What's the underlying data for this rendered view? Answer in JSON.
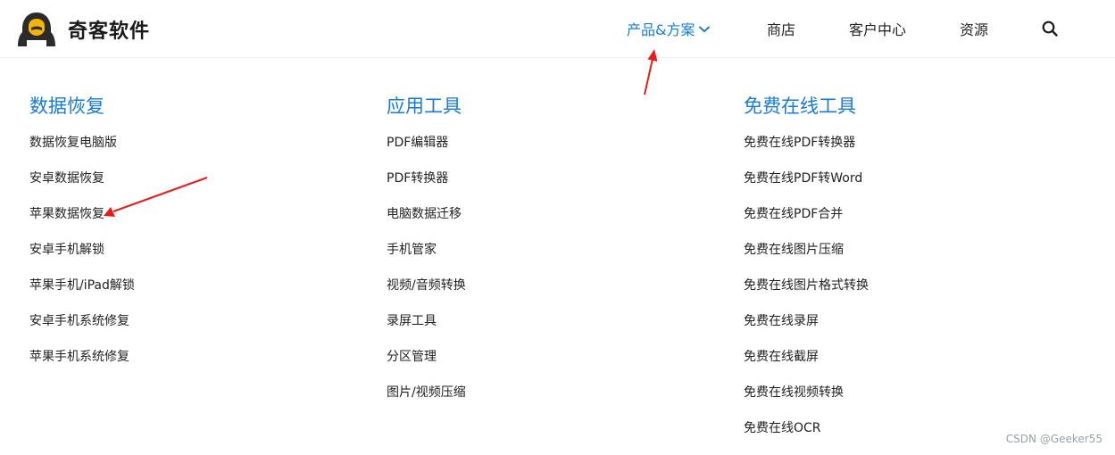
{
  "brand": {
    "name": "奇客软件",
    "logo_icon": "hooded-figure-icon"
  },
  "nav": {
    "products_label": "产品&方案",
    "store_label": "商店",
    "support_label": "客户中心",
    "resources_label": "资源",
    "search_icon": "search-icon"
  },
  "menu": {
    "columns": [
      {
        "title": "数据恢复",
        "items": [
          "数据恢复电脑版",
          "安卓数据恢复",
          "苹果数据恢复",
          "安卓手机解锁",
          "苹果手机/iPad解锁",
          "安卓手机系统修复",
          "苹果手机系统修复"
        ]
      },
      {
        "title": "应用工具",
        "items": [
          "PDF编辑器",
          "PDF转换器",
          "电脑数据迁移",
          "手机管家",
          "视频/音频转换",
          "录屏工具",
          "分区管理",
          "图片/视频压缩"
        ]
      },
      {
        "title": "免费在线工具",
        "items": [
          "免费在线PDF转换器",
          "免费在线PDF转Word",
          "免费在线PDF合并",
          "免费在线图片压缩",
          "免费在线图片格式转换",
          "免费在线录屏",
          "免费在线截屏",
          "免费在线视频转换",
          "免费在线OCR"
        ]
      }
    ]
  },
  "colors": {
    "accent": "#1a7bd6",
    "annotation_arrow": "#e81c1c"
  },
  "watermark": "CSDN @Geeker55"
}
